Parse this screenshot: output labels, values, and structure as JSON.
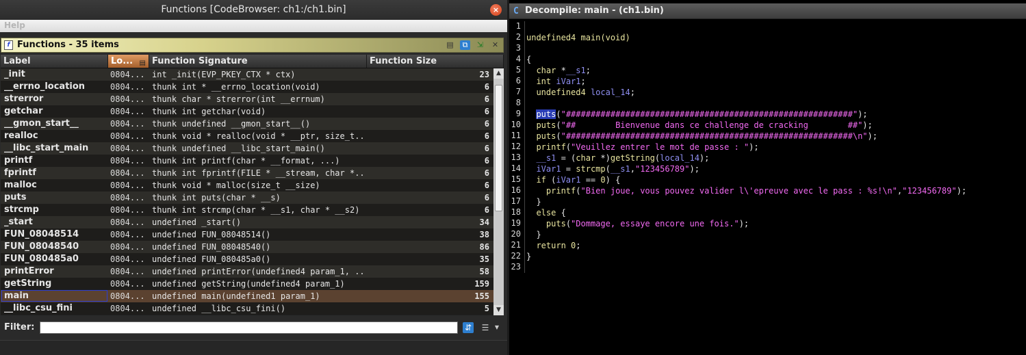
{
  "left_window": {
    "title": "Functions [CodeBrowser: ch1:/ch1.bin]",
    "close_glyph": "×",
    "menu": {
      "help": "Help"
    },
    "panel_title": "Functions - 35 items",
    "columns": [
      "Label",
      "Lo...",
      "Function Signature",
      "Function Size"
    ],
    "rows": [
      {
        "label": "_init",
        "loc": "0804...",
        "sig": "int _init(EVP_PKEY_CTX * ctx)",
        "size": "23"
      },
      {
        "label": "__errno_location",
        "loc": "0804...",
        "sig": "thunk int * __errno_location(void)",
        "size": "6"
      },
      {
        "label": "strerror",
        "loc": "0804...",
        "sig": "thunk char * strerror(int __errnum)",
        "size": "6"
      },
      {
        "label": "getchar",
        "loc": "0804...",
        "sig": "thunk int getchar(void)",
        "size": "6"
      },
      {
        "label": "__gmon_start__",
        "loc": "0804...",
        "sig": "thunk undefined __gmon_start__()",
        "size": "6"
      },
      {
        "label": "realloc",
        "loc": "0804...",
        "sig": "thunk void * realloc(void * __ptr, size_t...",
        "size": "6"
      },
      {
        "label": "__libc_start_main",
        "loc": "0804...",
        "sig": "thunk undefined __libc_start_main()",
        "size": "6"
      },
      {
        "label": "printf",
        "loc": "0804...",
        "sig": "thunk int printf(char * __format, ...)",
        "size": "6"
      },
      {
        "label": "fprintf",
        "loc": "0804...",
        "sig": "thunk int fprintf(FILE * __stream, char *...",
        "size": "6"
      },
      {
        "label": "malloc",
        "loc": "0804...",
        "sig": "thunk void * malloc(size_t __size)",
        "size": "6"
      },
      {
        "label": "puts",
        "loc": "0804...",
        "sig": "thunk int puts(char * __s)",
        "size": "6"
      },
      {
        "label": "strcmp",
        "loc": "0804...",
        "sig": "thunk int strcmp(char * __s1, char * __s2)",
        "size": "6"
      },
      {
        "label": "_start",
        "loc": "0804...",
        "sig": "undefined _start()",
        "size": "34"
      },
      {
        "label": "FUN_08048514",
        "loc": "0804...",
        "sig": "undefined FUN_08048514()",
        "size": "38"
      },
      {
        "label": "FUN_08048540",
        "loc": "0804...",
        "sig": "undefined FUN_08048540()",
        "size": "86"
      },
      {
        "label": "FUN_080485a0",
        "loc": "0804...",
        "sig": "undefined FUN_080485a0()",
        "size": "35"
      },
      {
        "label": "printError",
        "loc": "0804...",
        "sig": "undefined printError(undefined4 param_1, ...",
        "size": "58"
      },
      {
        "label": "getString",
        "loc": "0804...",
        "sig": "undefined getString(undefined4 param_1)",
        "size": "159"
      },
      {
        "label": "main",
        "loc": "0804...",
        "sig": "undefined main(undefined1 param_1)",
        "size": "155",
        "selected": true
      },
      {
        "label": "__libc_csu_fini",
        "loc": "0804...",
        "sig": "undefined __libc_csu_fini()",
        "size": "5"
      }
    ],
    "filter": {
      "label": "Filter:",
      "value": ""
    }
  },
  "right_window": {
    "title": "Decompile: main -  (ch1.bin)",
    "icon_glyph": "C",
    "code_lines": [
      [],
      [
        [
          "undefined4 main(void)",
          "type"
        ]
      ],
      [],
      [
        [
          "{",
          "pun"
        ]
      ],
      [
        [
          "  ",
          "pun"
        ],
        [
          "char",
          "type"
        ],
        [
          " *",
          "pun"
        ],
        [
          "__s1",
          "var"
        ],
        [
          ";",
          "pun"
        ]
      ],
      [
        [
          "  ",
          "pun"
        ],
        [
          "int",
          "type"
        ],
        [
          " ",
          "pun"
        ],
        [
          "iVar1",
          "var"
        ],
        [
          ";",
          "pun"
        ]
      ],
      [
        [
          "  ",
          "pun"
        ],
        [
          "undefined4",
          "type"
        ],
        [
          " ",
          "pun"
        ],
        [
          "local_14",
          "var"
        ],
        [
          ";",
          "pun"
        ]
      ],
      [],
      [
        [
          "  ",
          "pun"
        ],
        [
          "puts",
          "hl"
        ],
        [
          "(",
          "pun"
        ],
        [
          "\"##########################################################\"",
          "str"
        ],
        [
          ");",
          "pun"
        ]
      ],
      [
        [
          "  ",
          "pun"
        ],
        [
          "puts",
          "fn"
        ],
        [
          "(",
          "pun"
        ],
        [
          "\"##        Bienvenue dans ce challenge de cracking        ##\"",
          "str"
        ],
        [
          ");",
          "pun"
        ]
      ],
      [
        [
          "  ",
          "pun"
        ],
        [
          "puts",
          "fn"
        ],
        [
          "(",
          "pun"
        ],
        [
          "\"##########################################################\\n\"",
          "str"
        ],
        [
          ");",
          "pun"
        ]
      ],
      [
        [
          "  ",
          "pun"
        ],
        [
          "printf",
          "fn"
        ],
        [
          "(",
          "pun"
        ],
        [
          "\"Veuillez entrer le mot de passe : \"",
          "str"
        ],
        [
          ");",
          "pun"
        ]
      ],
      [
        [
          "  ",
          "pun"
        ],
        [
          "__s1",
          "var"
        ],
        [
          " = (",
          "pun"
        ],
        [
          "char",
          "type"
        ],
        [
          " *)",
          "pun"
        ],
        [
          "getString",
          "fn"
        ],
        [
          "(",
          "pun"
        ],
        [
          "local_14",
          "var"
        ],
        [
          ");",
          "pun"
        ]
      ],
      [
        [
          "  ",
          "pun"
        ],
        [
          "iVar1",
          "var"
        ],
        [
          " = ",
          "pun"
        ],
        [
          "strcmp",
          "fn"
        ],
        [
          "(",
          "pun"
        ],
        [
          "__s1",
          "var"
        ],
        [
          ",",
          "pun"
        ],
        [
          "\"123456789\"",
          "str"
        ],
        [
          ");",
          "pun"
        ]
      ],
      [
        [
          "  ",
          "pun"
        ],
        [
          "if",
          "kw"
        ],
        [
          " (",
          "pun"
        ],
        [
          "iVar1",
          "var"
        ],
        [
          " == ",
          "pun"
        ],
        [
          "0",
          "num"
        ],
        [
          ") {",
          "pun"
        ]
      ],
      [
        [
          "    ",
          "pun"
        ],
        [
          "printf",
          "fn"
        ],
        [
          "(",
          "pun"
        ],
        [
          "\"Bien joue, vous pouvez valider l\\'epreuve avec le pass : %s!\\n\"",
          "str"
        ],
        [
          ",",
          "pun"
        ],
        [
          "\"123456789\"",
          "str"
        ],
        [
          ");",
          "pun"
        ]
      ],
      [
        [
          "  }",
          "pun"
        ]
      ],
      [
        [
          "  ",
          "pun"
        ],
        [
          "else",
          "kw"
        ],
        [
          " {",
          "pun"
        ]
      ],
      [
        [
          "    ",
          "pun"
        ],
        [
          "puts",
          "fn"
        ],
        [
          "(",
          "pun"
        ],
        [
          "\"Dommage, essaye encore une fois.\"",
          "str"
        ],
        [
          ");",
          "pun"
        ]
      ],
      [
        [
          "  }",
          "pun"
        ]
      ],
      [
        [
          "  ",
          "pun"
        ],
        [
          "return",
          "kw"
        ],
        [
          " ",
          "pun"
        ],
        [
          "0",
          "num"
        ],
        [
          ";",
          "pun"
        ]
      ],
      [
        [
          "}",
          "pun"
        ]
      ],
      []
    ]
  }
}
